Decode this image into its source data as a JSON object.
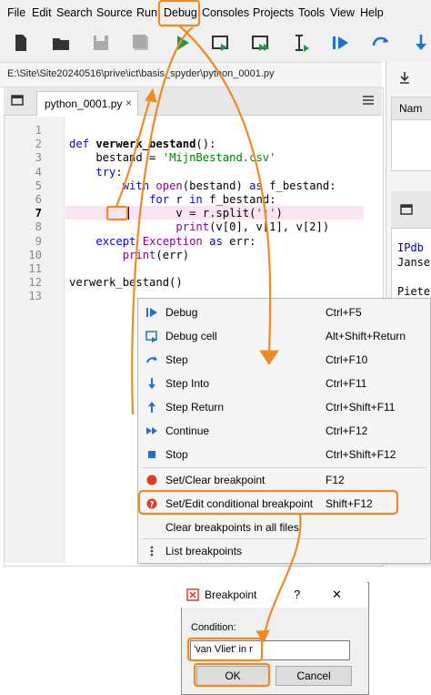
{
  "menubar": {
    "items": [
      "File",
      "Edit",
      "Search",
      "Source",
      "Run",
      "Debug",
      "Consoles",
      "Projects",
      "Tools",
      "View",
      "Help"
    ]
  },
  "pathbar": {
    "path": "E:\\Site\\Site20240516\\prive\\ict\\basis_spyder\\python_0001.py"
  },
  "editor": {
    "tab_label": "python_0001.py",
    "tab_close": "×",
    "line_numbers": [
      "1",
      "2",
      "3",
      "4",
      "5",
      "6",
      "7",
      "8",
      "9",
      "10",
      "11",
      "12",
      "13"
    ],
    "lines": [
      "",
      "def verwerk_bestand():",
      "    bestand = 'MijnBestand.csv'",
      "    try:",
      "        with open(bestand) as f_bestand:",
      "            for r in f_bestand:",
      "                v = r.split(';')",
      "                print(v[0], v[1], v[2])",
      "    except Exception as err:",
      "        print(err)",
      "",
      "verwerk_bestand()",
      ""
    ]
  },
  "right_panel": {
    "var_header": "Nam",
    "console_lines": [
      "IPdb",
      "Janse",
      "",
      "Piete"
    ]
  },
  "debug_menu": {
    "items": [
      {
        "label": "Debug",
        "shortcut": "Ctrl+F5",
        "icon": "debug-icon"
      },
      {
        "label": "Debug cell",
        "shortcut": "Alt+Shift+Return",
        "icon": "debug-cell-icon"
      },
      {
        "label": "Step",
        "shortcut": "Ctrl+F10",
        "icon": "step-icon"
      },
      {
        "label": "Step Into",
        "shortcut": "Ctrl+F11",
        "icon": "step-into-icon"
      },
      {
        "label": "Step Return",
        "shortcut": "Ctrl+Shift+F11",
        "icon": "step-return-icon"
      },
      {
        "label": "Continue",
        "shortcut": "Ctrl+F12",
        "icon": "continue-icon"
      },
      {
        "label": "Stop",
        "shortcut": "Ctrl+Shift+F12",
        "icon": "stop-icon"
      },
      {
        "label": "Set/Clear breakpoint",
        "shortcut": "F12",
        "icon": "breakpoint-icon"
      },
      {
        "label": "Set/Edit conditional breakpoint",
        "shortcut": "Shift+F12",
        "icon": "conditional-breakpoint-icon"
      },
      {
        "label": "Clear breakpoints in all files",
        "shortcut": "",
        "icon": ""
      },
      {
        "label": "List breakpoints",
        "shortcut": "",
        "icon": "list-icon"
      }
    ]
  },
  "dialog": {
    "title": "Breakpoint",
    "help": "?",
    "close": "✕",
    "condition_label": "Condition:",
    "condition_value": "'van Vliet' in r",
    "ok_label": "OK",
    "cancel_label": "Cancel"
  },
  "colors": {
    "annotation": "#f08a24",
    "breakpoint_red": "#e03a2a",
    "toolbar_blue": "#1e6fd6",
    "run_green": "#1c9a3c"
  }
}
